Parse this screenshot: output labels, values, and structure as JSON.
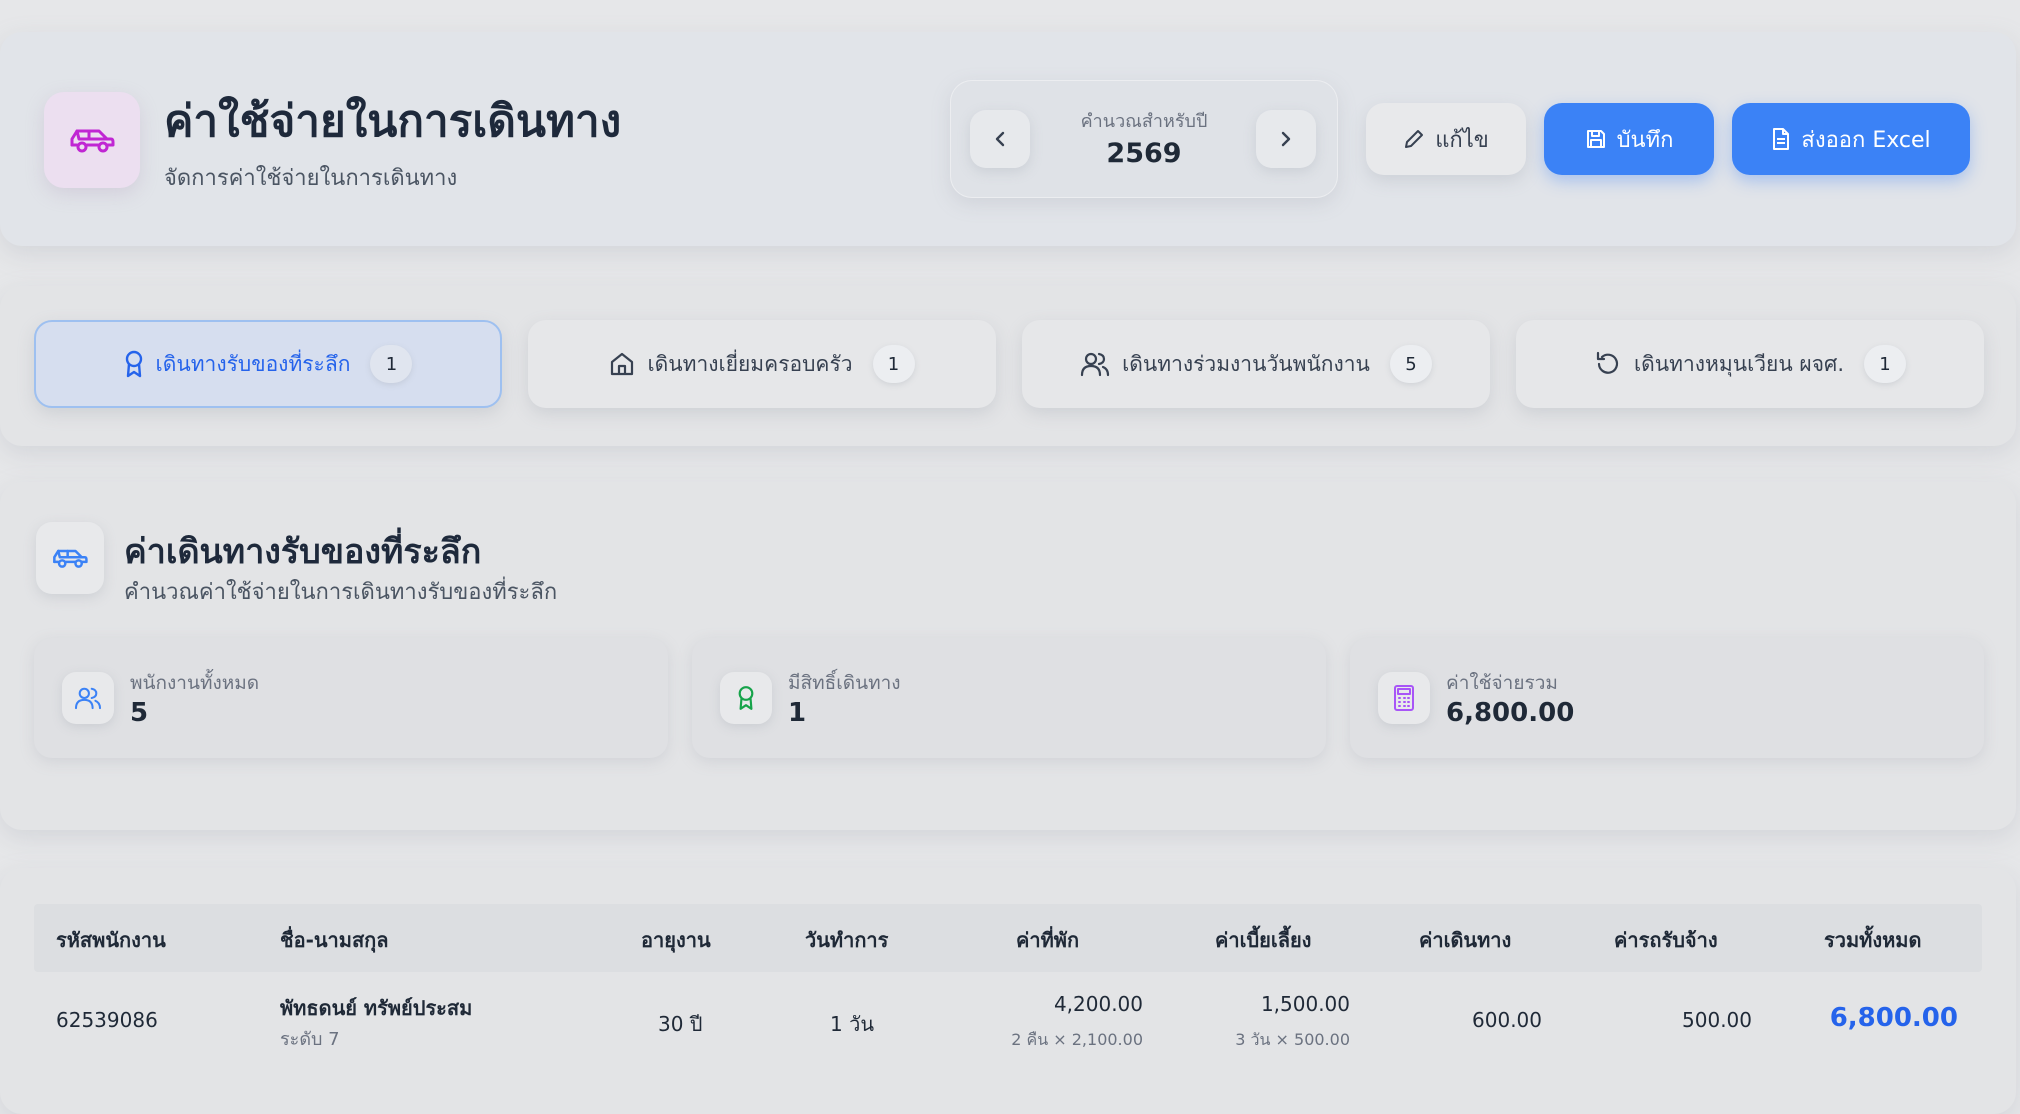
{
  "header": {
    "title": "ค่าใช้จ่ายในการเดินทาง",
    "subtitle": "จัดการค่าใช้จ่ายในการเดินทาง",
    "icon": "car-icon",
    "year_label": "คำนวณสำหรับปี",
    "year": "2569",
    "edit_label": "แก้ไข",
    "save_label": "บันทึก",
    "export_label": "ส่งออก Excel"
  },
  "tabs": [
    {
      "label": "เดินทางรับของที่ระลึก",
      "count": "1",
      "icon": "award-icon",
      "active": true
    },
    {
      "label": "เดินทางเยี่ยมครอบครัว",
      "count": "1",
      "icon": "home-icon",
      "active": false
    },
    {
      "label": "เดินทางร่วมงานวันพนักงาน",
      "count": "5",
      "icon": "users-icon",
      "active": false
    },
    {
      "label": "เดินทางหมุนเวียน ผจศ.",
      "count": "1",
      "icon": "rotate-icon",
      "active": false
    }
  ],
  "section": {
    "title": "ค่าเดินทางรับของที่ระลึก",
    "subtitle": "คำนวณค่าใช้จ่ายในการเดินทางรับของที่ระลึก",
    "icon": "car-icon"
  },
  "stats": [
    {
      "label": "พนักงานทั้งหมด",
      "value": "5",
      "icon": "users-icon"
    },
    {
      "label": "มีสิทธิ์เดินทาง",
      "value": "1",
      "icon": "award-icon"
    },
    {
      "label": "ค่าใช้จ่ายรวม",
      "value": "6,800.00",
      "icon": "calculator-icon"
    }
  ],
  "table": {
    "columns": [
      "รหัสพนักงาน",
      "ชื่อ-นามสกุล",
      "อายุงาน",
      "วันทำการ",
      "ค่าที่พัก",
      "ค่าเบี้ยเลี้ยง",
      "ค่าเดินทาง",
      "ค่ารถรับจ้าง",
      "รวมทั้งหมด"
    ],
    "rows": [
      {
        "employee_id": "62539086",
        "name": "พัทธดนย์ ทรัพย์ประสม",
        "level": "ระดับ 7",
        "tenure": "30 ปี",
        "work_days": "1 วัน",
        "lodging": "4,200.00",
        "lodging_detail": "2 คืน × 2,100.00",
        "allowance": "1,500.00",
        "allowance_detail": "3 วัน × 500.00",
        "travel": "600.00",
        "taxi": "500.00",
        "total": "6,800.00"
      }
    ]
  },
  "colors": {
    "accent": "#3b82f6",
    "purple_icon": "#c026d3",
    "green_icon": "#16a34a",
    "calc_icon": "#a855f7"
  }
}
